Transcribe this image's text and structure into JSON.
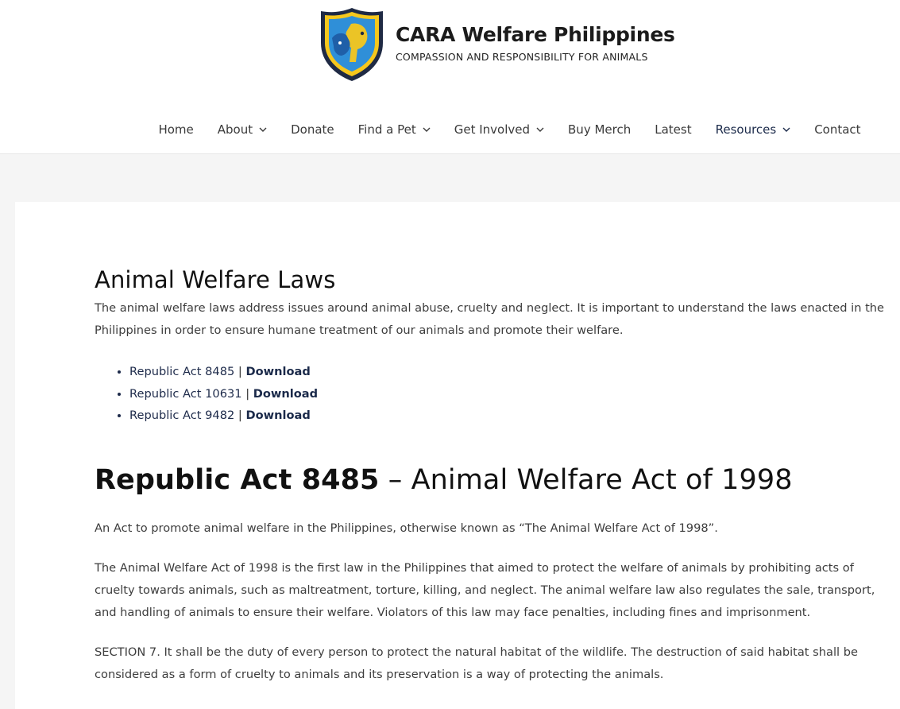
{
  "site": {
    "title": "CARA Welfare Philippines",
    "tagline": "COMPASSION AND RESPONSIBILITY FOR ANIMALS",
    "logo_icon": "shield-cat-dog-logo",
    "colors": {
      "shield_blue": "#2f8fd8",
      "shield_yellow": "#f6c71c",
      "shield_border": "#1f2a44"
    }
  },
  "nav": {
    "items": [
      {
        "label": "Home",
        "dropdown": false
      },
      {
        "label": "About",
        "dropdown": true
      },
      {
        "label": "Donate",
        "dropdown": false
      },
      {
        "label": "Find a Pet",
        "dropdown": true
      },
      {
        "label": "Get Involved",
        "dropdown": true
      },
      {
        "label": "Buy Merch",
        "dropdown": false
      },
      {
        "label": "Latest",
        "dropdown": false
      },
      {
        "label": "Resources",
        "dropdown": true,
        "active": true
      },
      {
        "label": "Contact",
        "dropdown": false
      }
    ]
  },
  "content": {
    "section_title": "Animal Welfare Laws",
    "intro": "The animal welfare laws address issues around animal abuse, cruelty and neglect. It is important to understand the laws enacted in the Philippines in order to ensure humane treatment of our animals and promote their welfare.",
    "acts": [
      {
        "name": "Republic Act 8485",
        "separator": "|",
        "link": "Download"
      },
      {
        "name": "Republic Act 10631",
        "separator": "|",
        "link": "Download"
      },
      {
        "name": "Republic Act 9482",
        "separator": "|",
        "link": "Download"
      }
    ],
    "act_heading_strong": "Republic Act 8485",
    "act_heading_rest": " – Animal Welfare Act of 1998",
    "paragraphs": [
      "An Act to promote animal welfare in the Philippines, otherwise known as “The Animal Welfare Act of 1998”.",
      "The Animal Welfare Act of 1998 is the first law in the Philippines that aimed to protect the welfare of animals by prohibiting acts of cruelty towards animals, such as maltreatment, torture, killing, and neglect. The animal welfare law also regulates the sale, transport, and handling of animals to ensure their welfare. Violators of this law may face penalties, including fines and imprisonment.",
      "SECTION 7. It shall be the duty of every person to protect the natural habitat of the wildlife. The destruction of said habitat shall be considered as a form of cruelty to animals and its preservation is a way of protecting the animals."
    ]
  }
}
